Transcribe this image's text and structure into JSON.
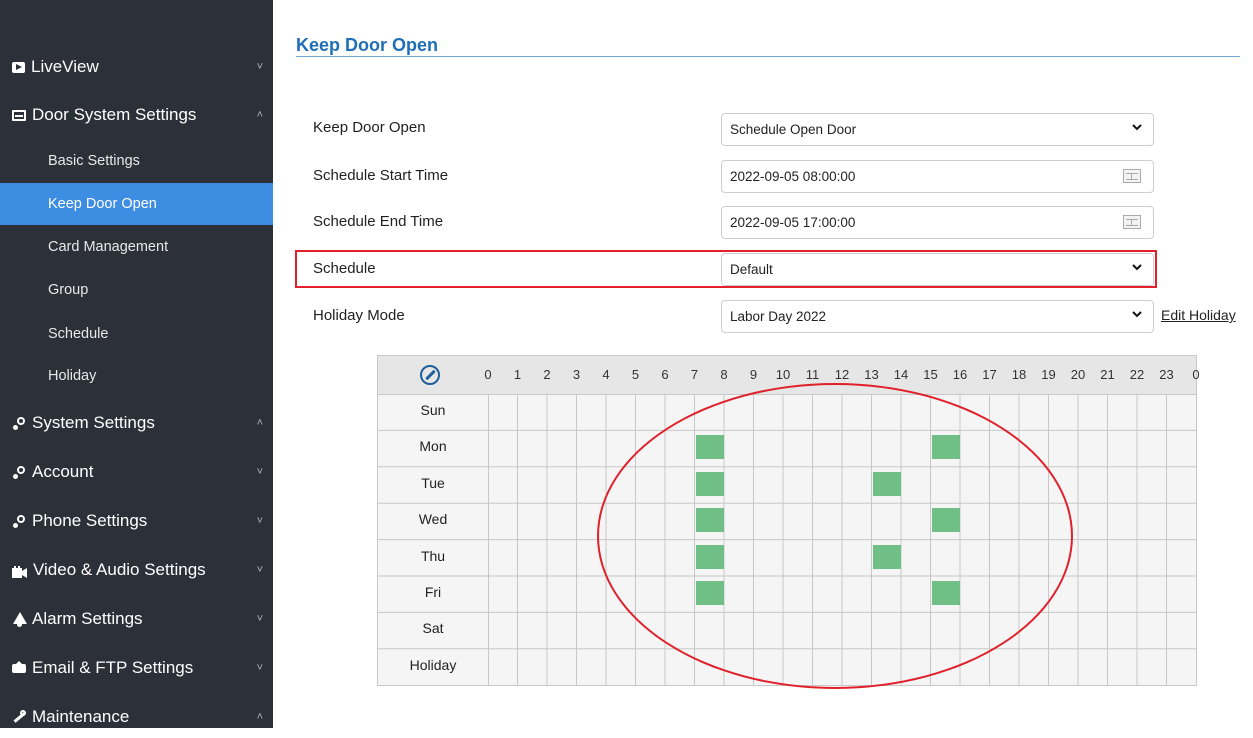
{
  "sidebar": {
    "liveview": "LiveView",
    "door_system": "Door System Settings",
    "sub_items": [
      "Basic Settings",
      "Keep Door Open",
      "Card Management",
      "Group",
      "Schedule",
      "Holiday"
    ],
    "system_settings": "System Settings",
    "account": "Account",
    "phone_settings": "Phone Settings",
    "video_audio": "Video & Audio Settings",
    "alarm": "Alarm Settings",
    "email_ftp": "Email & FTP Settings",
    "maintenance": "Maintenance",
    "active_item": "Keep Door Open"
  },
  "page": {
    "title": "Keep Door Open"
  },
  "form": {
    "keep_door_open_label": "Keep Door Open",
    "keep_door_open_value": "Schedule Open Door",
    "start_time_label": "Schedule Start Time",
    "start_time_value": "2022-09-05 08:00:00",
    "end_time_label": "Schedule End Time",
    "end_time_value": "2022-09-05 17:00:00",
    "schedule_label": "Schedule",
    "schedule_value": "Default",
    "holiday_mode_label": "Holiday Mode",
    "holiday_mode_value": "Labor Day 2022",
    "edit_holiday_link": "Edit Holiday"
  },
  "grid": {
    "hours": [
      "0",
      "1",
      "2",
      "3",
      "4",
      "5",
      "6",
      "7",
      "8",
      "9",
      "10",
      "11",
      "12",
      "13",
      "14",
      "15",
      "16",
      "17",
      "18",
      "19",
      "20",
      "21",
      "22",
      "23",
      "0"
    ],
    "days": [
      "Sun",
      "Mon",
      "Tue",
      "Wed",
      "Thu",
      "Fri",
      "Sat",
      "Holiday"
    ],
    "active_slots": [
      {
        "day": "Mon",
        "hour": 7
      },
      {
        "day": "Mon",
        "hour": 15
      },
      {
        "day": "Tue",
        "hour": 7
      },
      {
        "day": "Tue",
        "hour": 13
      },
      {
        "day": "Wed",
        "hour": 7
      },
      {
        "day": "Wed",
        "hour": 15
      },
      {
        "day": "Thu",
        "hour": 7
      },
      {
        "day": "Thu",
        "hour": 13
      },
      {
        "day": "Fri",
        "hour": 7
      },
      {
        "day": "Fri",
        "hour": 15
      }
    ],
    "active_color": "#6fbf86"
  },
  "colors": {
    "sidebar_bg": "#2b3039",
    "active_bg": "#3d8de2",
    "title": "#1e6fb5",
    "highlight": "#e0202a"
  }
}
